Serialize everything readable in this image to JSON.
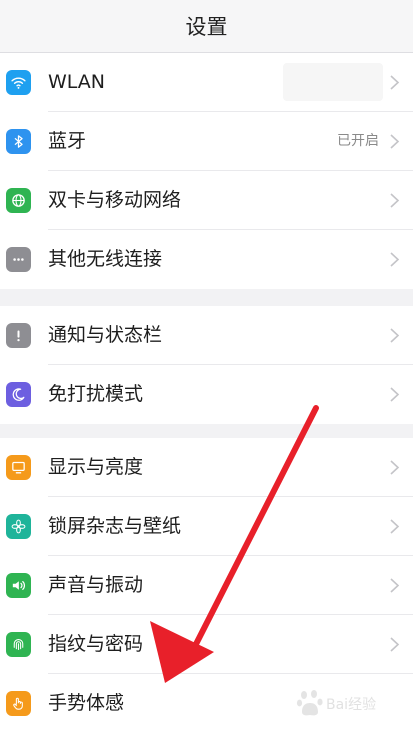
{
  "header": {
    "title": "设置"
  },
  "groups": [
    {
      "items": [
        {
          "label": "WLAN",
          "icon": "wifi-icon",
          "color": "#1ea0f0"
        },
        {
          "label": "蓝牙",
          "icon": "bluetooth-icon",
          "color": "#2e93ef",
          "status": "已开启"
        },
        {
          "label": "双卡与移动网络",
          "icon": "globe-icon",
          "color": "#2fb452"
        },
        {
          "label": "其他无线连接",
          "icon": "more-dots-icon",
          "color": "#8e8e93"
        }
      ]
    },
    {
      "items": [
        {
          "label": "通知与状态栏",
          "icon": "exclamation-icon",
          "color": "#8e8e93"
        },
        {
          "label": "免打扰模式",
          "icon": "moon-icon",
          "color": "#6d5fe0"
        }
      ]
    },
    {
      "items": [
        {
          "label": "显示与亮度",
          "icon": "monitor-icon",
          "color": "#f59a1b"
        },
        {
          "label": "锁屏杂志与壁纸",
          "icon": "flower-icon",
          "color": "#1fb49a"
        },
        {
          "label": "声音与振动",
          "icon": "speaker-icon",
          "color": "#2fb452"
        },
        {
          "label": "指纹与密码",
          "icon": "fingerprint-icon",
          "color": "#2fb452"
        },
        {
          "label": "手势体感",
          "icon": "hand-icon",
          "color": "#f59a1b"
        }
      ]
    }
  ],
  "annotation": {
    "color": "#e8202a"
  },
  "watermark": {
    "text": "Bai经验",
    "logo": "baidu-paw-logo"
  }
}
